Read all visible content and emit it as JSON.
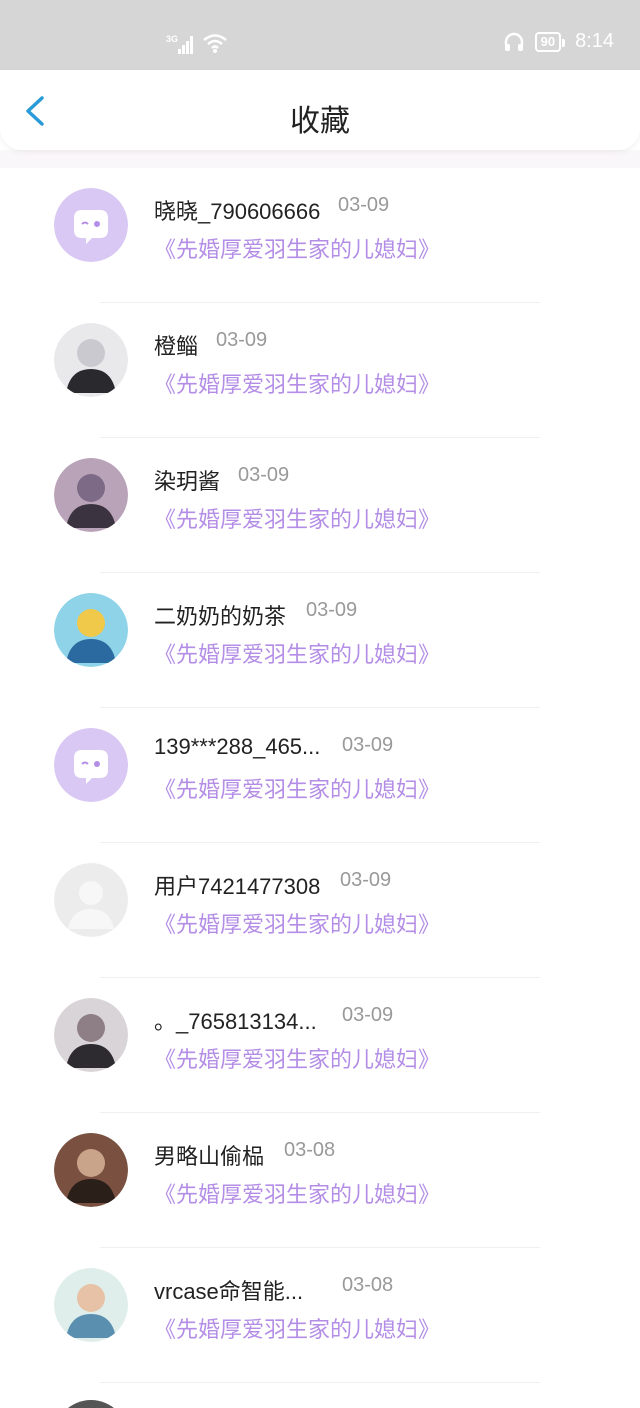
{
  "status_bar": {
    "network": "3G",
    "battery": "90",
    "time": "8:14",
    "icons": [
      "signal-icon",
      "wifi-icon",
      "headphones-icon",
      "battery-icon"
    ]
  },
  "header": {
    "title": "收藏",
    "back_icon": "chevron-left-icon",
    "accent_color": "#2a9bd8"
  },
  "colors": {
    "book_title": "#b48ee6",
    "date": "#999999",
    "default_avatar_bg": "#d8c8f3"
  },
  "items": [
    {
      "name": "晓晓_790606666",
      "date": "03-09",
      "book": "《先婚厚爱羽生家的儿媳妇》",
      "avatar": "default-chat-avatar"
    },
    {
      "name": "橙鲻",
      "date": "03-09",
      "book": "《先婚厚爱羽生家的儿媳妇》",
      "avatar": "photo-avatar"
    },
    {
      "name": "染玥酱",
      "date": "03-09",
      "book": "《先婚厚爱羽生家的儿媳妇》",
      "avatar": "photo-avatar"
    },
    {
      "name": "二奶奶的奶茶",
      "date": "03-09",
      "book": "《先婚厚爱羽生家的儿媳妇》",
      "avatar": "photo-avatar"
    },
    {
      "name": "139***288_465...",
      "date": "03-09",
      "book": "《先婚厚爱羽生家的儿媳妇》",
      "avatar": "default-chat-avatar"
    },
    {
      "name": "用户7421477308",
      "date": "03-09",
      "book": "《先婚厚爱羽生家的儿媳妇》",
      "avatar": "blank-user-avatar"
    },
    {
      "name": "。_765813134...",
      "date": "03-09",
      "book": "《先婚厚爱羽生家的儿媳妇》",
      "avatar": "photo-avatar"
    },
    {
      "name": "男略山偷榀",
      "date": "03-08",
      "book": "《先婚厚爱羽生家的儿媳妇》",
      "avatar": "photo-avatar"
    },
    {
      "name": "vrcase命智能...",
      "date": "03-08",
      "book": "《先婚厚爱羽生家的儿媳妇》",
      "avatar": "photo-avatar"
    }
  ]
}
